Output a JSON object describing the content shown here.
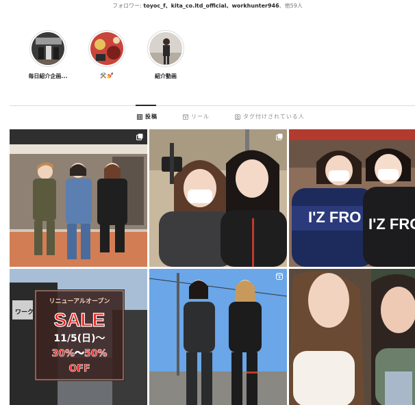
{
  "followers_prefix": "フォロワー: ",
  "followers_names": "toyoc_f、kita_co.ltd_official、workhunter946",
  "followers_suffix": "、他59人",
  "highlights": [
    {
      "label": "毎日紹介企画..."
    },
    {
      "label": "⚒️💅"
    },
    {
      "label": "紹介動画"
    }
  ],
  "tabs": [
    {
      "label": "投稿",
      "active": true
    },
    {
      "label": "リール",
      "active": false
    },
    {
      "label": "タグ付けされている人",
      "active": false
    }
  ],
  "posts": [
    {
      "kind": "group-photo-three"
    },
    {
      "kind": "selfie-two"
    },
    {
      "kind": "izfro-two"
    },
    {
      "kind": "sale-poster",
      "sign": "リニューアルオープン",
      "headline": "SALE",
      "date": "11/5(日)〜",
      "discount": "30%〜50%",
      "off": "OFF",
      "store_sign": "ワーク"
    },
    {
      "kind": "reel-two-black"
    },
    {
      "kind": "selfie-close"
    }
  ],
  "shirt_text": "I'Z FRO",
  "colors": {
    "text": "#262626",
    "muted": "#8e8e8e",
    "border": "#dbdbdb",
    "sale_red": "#e8231e"
  }
}
